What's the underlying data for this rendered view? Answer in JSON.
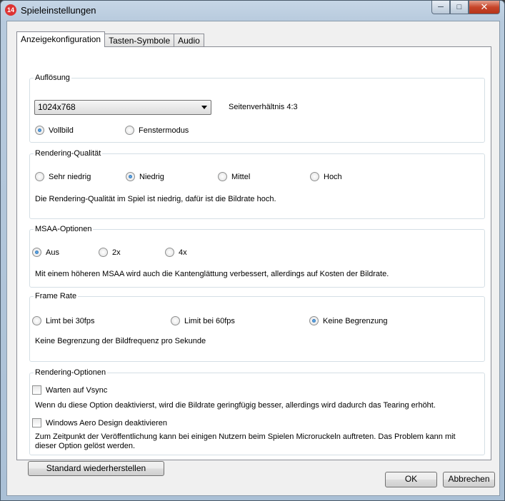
{
  "window": {
    "title": "Spieleinstellungen",
    "app_icon_text": "14"
  },
  "tabs": [
    "Anzeigekonfiguration",
    "Tasten-Symbole",
    "Audio"
  ],
  "resolution": {
    "legend": "Auflösung",
    "selected": "1024x768",
    "aspect": "Seitenverhältnis 4:3",
    "modes": [
      "Vollbild",
      "Fenstermodus"
    ],
    "selected_mode": "Vollbild"
  },
  "quality": {
    "legend": "Rendering-Qualität",
    "options": [
      "Sehr niedrig",
      "Niedrig",
      "Mittel",
      "Hoch"
    ],
    "selected": "Niedrig",
    "description": "Die Rendering-Qualität im Spiel ist niedrig, dafür ist die Bildrate hoch."
  },
  "msaa": {
    "legend": "MSAA-Optionen",
    "options": [
      "Aus",
      "2x",
      "4x"
    ],
    "selected": "Aus",
    "description": "Mit einem höheren MSAA wird auch die Kantenglättung verbessert, allerdings auf Kosten der Bildrate."
  },
  "framerate": {
    "legend": "Frame Rate",
    "options": [
      "Limt bei 30fps",
      "Limit bei 60fps",
      "Keine Begrenzung"
    ],
    "selected": "Keine Begrenzung",
    "description": "Keine Begrenzung der Bildfrequenz pro Sekunde"
  },
  "rendering_options": {
    "legend": "Rendering-Optionen",
    "vsync_label": "Warten auf Vsync",
    "vsync_checked": false,
    "vsync_description": "Wenn du diese Option deaktivierst, wird die Bildrate geringfügig besser, allerdings wird dadurch das Tearing erhöht.",
    "aero_label": "Windows Aero Design deaktivieren",
    "aero_checked": false,
    "aero_description": "Zum Zeitpunkt der Veröffentlichung kann bei einigen Nutzern beim Spielen Microruckeln auftreten. Das Problem kann mit dieser Option gelöst werden."
  },
  "buttons": {
    "reset": "Standard wiederherstellen",
    "ok": "OK",
    "cancel": "Abbrechen"
  }
}
